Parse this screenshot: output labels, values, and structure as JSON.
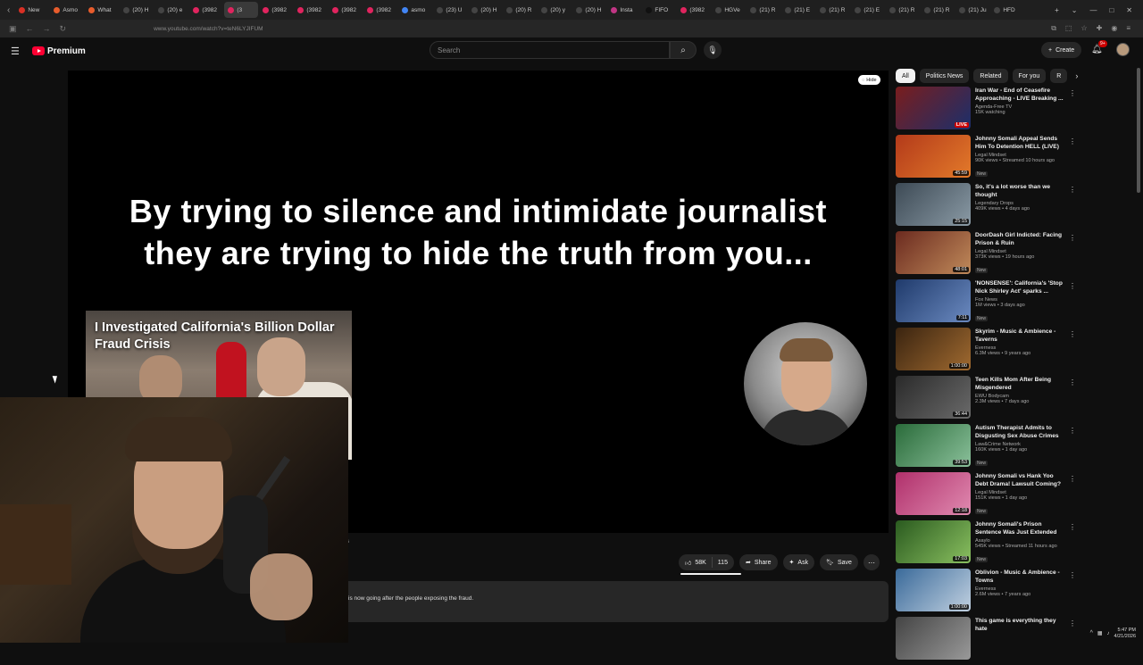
{
  "browser": {
    "tabs": [
      {
        "label": "New",
        "color": "#d93025"
      },
      {
        "label": "Asmo",
        "color": "#e85c2c"
      },
      {
        "label": "What",
        "color": "#e85c2c"
      },
      {
        "label": "(20) H",
        "color": "#444"
      },
      {
        "label": "(20) e",
        "color": "#444"
      },
      {
        "label": "(3982",
        "color": "#e0245e"
      },
      {
        "label": "(3",
        "color": "#e0245e",
        "active": true
      },
      {
        "label": "(3982",
        "color": "#e0245e"
      },
      {
        "label": "(3982",
        "color": "#e0245e"
      },
      {
        "label": "(3982",
        "color": "#e0245e"
      },
      {
        "label": "(3982",
        "color": "#e0245e"
      },
      {
        "label": "asmo",
        "color": "#4285f4"
      },
      {
        "label": "(23) U",
        "color": "#444"
      },
      {
        "label": "(20) H",
        "color": "#444"
      },
      {
        "label": "(20) R",
        "color": "#444"
      },
      {
        "label": "(20) y",
        "color": "#444"
      },
      {
        "label": "(20) H",
        "color": "#444"
      },
      {
        "label": "Insta",
        "color": "#c13584"
      },
      {
        "label": "FIFO",
        "color": "#111"
      },
      {
        "label": "(3982",
        "color": "#e0245e"
      },
      {
        "label": "HGVe",
        "color": "#444"
      },
      {
        "label": "(21) R",
        "color": "#444"
      },
      {
        "label": "(21) E",
        "color": "#444"
      },
      {
        "label": "(21) R",
        "color": "#444"
      },
      {
        "label": "(21) E",
        "color": "#444"
      },
      {
        "label": "(21) R",
        "color": "#444"
      },
      {
        "label": "(21) R",
        "color": "#444"
      },
      {
        "label": "(21) Ju",
        "color": "#444"
      },
      {
        "label": "HFD",
        "color": "#444"
      }
    ],
    "url": "www.youtube.com/watch?v=teN6LYJIFUM"
  },
  "header": {
    "brand": "Premium",
    "search_placeholder": "Search",
    "create_label": "Create",
    "notif_count": "9+"
  },
  "player": {
    "overlay_line1": "By trying to silence and intimidate journalist",
    "overlay_line2": "they are trying to hide the truth from you...",
    "hide_label": "Hide",
    "card_title": "I Investigated California's Billion Dollar Fraud Crisis"
  },
  "actions": {
    "likes": "58K",
    "dislikes": "115",
    "share": "Share",
    "ask": "Ask",
    "save": "Save"
  },
  "description": {
    "text": "is now going after the people exposing the fraud.",
    "fragment": "s"
  },
  "sidebar": {
    "chips": [
      "All",
      "Politics News",
      "Related",
      "For you",
      "R"
    ],
    "videos": [
      {
        "title": "Iran War - End of Ceasefire Approaching - LIVE Breaking ...",
        "channel": "Agenda-Free TV",
        "views": "15K watching",
        "badge": "",
        "overlay": "LIVE",
        "live": true,
        "c1": "#7a1d1d",
        "c2": "#1b2f6b"
      },
      {
        "title": "Johnny Somali Appeal Sends Him To Detention HELL (LIVE)",
        "channel": "Legal Mindset",
        "views": "90K views • Streamed 10 hours ago",
        "badge": "New",
        "overlay": "45:59",
        "live": false,
        "c1": "#b33a1a",
        "c2": "#e37a2a"
      },
      {
        "title": "So, it's a lot worse than we thought",
        "channel": "Legendary Drops",
        "views": "409K views • 4 days ago",
        "badge": "",
        "overlay": "25:15",
        "live": false,
        "c1": "#3d4a55",
        "c2": "#8a9aa5"
      },
      {
        "title": "DoorDash Girl Indicted: Facing Prison & Ruin",
        "channel": "Legal Mindset",
        "views": "373K views • 19 hours ago",
        "badge": "New",
        "overlay": "48:01",
        "live": false,
        "c1": "#6b2a1f",
        "c2": "#c08a5a"
      },
      {
        "title": "'NONSENSE': California's 'Stop Nick Shirley Act' sparks ...",
        "channel": "Fox News",
        "views": "1M views • 3 days ago",
        "badge": "New",
        "overlay": "7:11",
        "live": false,
        "c1": "#1f3a6b",
        "c2": "#6b8ac0"
      },
      {
        "title": "Skyrim - Music & Ambience - Taverns",
        "channel": "Everness",
        "views": "6.3M views • 9 years ago",
        "badge": "",
        "overlay": "1:00:00",
        "live": false,
        "c1": "#3a2410",
        "c2": "#a06a30"
      },
      {
        "title": "Teen Kills Mom After Being Misgendered",
        "channel": "EWU Bodycam",
        "views": "2.3M views • 7 days ago",
        "badge": "",
        "overlay": "36:44",
        "live": false,
        "c1": "#2a2a2a",
        "c2": "#6a6a6a"
      },
      {
        "title": "Autism Therapist Admits to Disgusting Sex Abuse Crimes",
        "channel": "Law&Crime Network",
        "views": "160K views • 1 day ago",
        "badge": "New",
        "overlay": "39:53",
        "live": false,
        "c1": "#2a6b3a",
        "c2": "#8ac09a"
      },
      {
        "title": "Johnny Somali vs Hank Yoo Debt Drama! Lawsuit Coming?",
        "channel": "Legal Mindset",
        "views": "151K views • 1 day ago",
        "badge": "New",
        "overlay": "12:18",
        "live": false,
        "c1": "#b0306b",
        "c2": "#e08ab0"
      },
      {
        "title": "Johnny Somali's Prison Sentence Was Just Extended",
        "channel": "Asaylo",
        "views": "545K views • Streamed 11 hours ago",
        "badge": "New",
        "overlay": "17:03",
        "live": false,
        "c1": "#2a5a1f",
        "c2": "#8ac060"
      },
      {
        "title": "Oblivion - Music & Ambience - Towns",
        "channel": "Everness",
        "views": "2.6M views • 7 years ago",
        "badge": "",
        "overlay": "1:00:00",
        "live": false,
        "c1": "#3a6a9a",
        "c2": "#c0d0e0"
      },
      {
        "title": "This game is everything they hate",
        "channel": "",
        "views": "",
        "badge": "",
        "overlay": "",
        "live": false,
        "c1": "#444",
        "c2": "#999"
      }
    ]
  },
  "system": {
    "time": "5:47 PM",
    "date": "4/21/2026"
  }
}
